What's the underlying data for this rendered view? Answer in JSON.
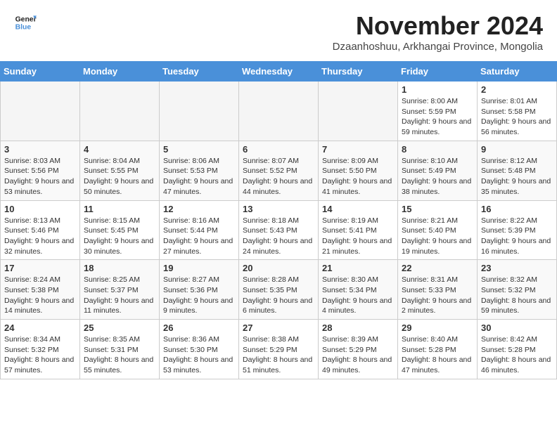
{
  "header": {
    "logo_line1": "General",
    "logo_line2": "Blue",
    "month_title": "November 2024",
    "subtitle": "Dzaanhoshuu, Arkhangai Province, Mongolia"
  },
  "weekdays": [
    "Sunday",
    "Monday",
    "Tuesday",
    "Wednesday",
    "Thursday",
    "Friday",
    "Saturday"
  ],
  "weeks": [
    [
      {
        "day": "",
        "info": ""
      },
      {
        "day": "",
        "info": ""
      },
      {
        "day": "",
        "info": ""
      },
      {
        "day": "",
        "info": ""
      },
      {
        "day": "",
        "info": ""
      },
      {
        "day": "1",
        "info": "Sunrise: 8:00 AM\nSunset: 5:59 PM\nDaylight: 9 hours and 59 minutes."
      },
      {
        "day": "2",
        "info": "Sunrise: 8:01 AM\nSunset: 5:58 PM\nDaylight: 9 hours and 56 minutes."
      }
    ],
    [
      {
        "day": "3",
        "info": "Sunrise: 8:03 AM\nSunset: 5:56 PM\nDaylight: 9 hours and 53 minutes."
      },
      {
        "day": "4",
        "info": "Sunrise: 8:04 AM\nSunset: 5:55 PM\nDaylight: 9 hours and 50 minutes."
      },
      {
        "day": "5",
        "info": "Sunrise: 8:06 AM\nSunset: 5:53 PM\nDaylight: 9 hours and 47 minutes."
      },
      {
        "day": "6",
        "info": "Sunrise: 8:07 AM\nSunset: 5:52 PM\nDaylight: 9 hours and 44 minutes."
      },
      {
        "day": "7",
        "info": "Sunrise: 8:09 AM\nSunset: 5:50 PM\nDaylight: 9 hours and 41 minutes."
      },
      {
        "day": "8",
        "info": "Sunrise: 8:10 AM\nSunset: 5:49 PM\nDaylight: 9 hours and 38 minutes."
      },
      {
        "day": "9",
        "info": "Sunrise: 8:12 AM\nSunset: 5:48 PM\nDaylight: 9 hours and 35 minutes."
      }
    ],
    [
      {
        "day": "10",
        "info": "Sunrise: 8:13 AM\nSunset: 5:46 PM\nDaylight: 9 hours and 32 minutes."
      },
      {
        "day": "11",
        "info": "Sunrise: 8:15 AM\nSunset: 5:45 PM\nDaylight: 9 hours and 30 minutes."
      },
      {
        "day": "12",
        "info": "Sunrise: 8:16 AM\nSunset: 5:44 PM\nDaylight: 9 hours and 27 minutes."
      },
      {
        "day": "13",
        "info": "Sunrise: 8:18 AM\nSunset: 5:43 PM\nDaylight: 9 hours and 24 minutes."
      },
      {
        "day": "14",
        "info": "Sunrise: 8:19 AM\nSunset: 5:41 PM\nDaylight: 9 hours and 21 minutes."
      },
      {
        "day": "15",
        "info": "Sunrise: 8:21 AM\nSunset: 5:40 PM\nDaylight: 9 hours and 19 minutes."
      },
      {
        "day": "16",
        "info": "Sunrise: 8:22 AM\nSunset: 5:39 PM\nDaylight: 9 hours and 16 minutes."
      }
    ],
    [
      {
        "day": "17",
        "info": "Sunrise: 8:24 AM\nSunset: 5:38 PM\nDaylight: 9 hours and 14 minutes."
      },
      {
        "day": "18",
        "info": "Sunrise: 8:25 AM\nSunset: 5:37 PM\nDaylight: 9 hours and 11 minutes."
      },
      {
        "day": "19",
        "info": "Sunrise: 8:27 AM\nSunset: 5:36 PM\nDaylight: 9 hours and 9 minutes."
      },
      {
        "day": "20",
        "info": "Sunrise: 8:28 AM\nSunset: 5:35 PM\nDaylight: 9 hours and 6 minutes."
      },
      {
        "day": "21",
        "info": "Sunrise: 8:30 AM\nSunset: 5:34 PM\nDaylight: 9 hours and 4 minutes."
      },
      {
        "day": "22",
        "info": "Sunrise: 8:31 AM\nSunset: 5:33 PM\nDaylight: 9 hours and 2 minutes."
      },
      {
        "day": "23",
        "info": "Sunrise: 8:32 AM\nSunset: 5:32 PM\nDaylight: 8 hours and 59 minutes."
      }
    ],
    [
      {
        "day": "24",
        "info": "Sunrise: 8:34 AM\nSunset: 5:32 PM\nDaylight: 8 hours and 57 minutes."
      },
      {
        "day": "25",
        "info": "Sunrise: 8:35 AM\nSunset: 5:31 PM\nDaylight: 8 hours and 55 minutes."
      },
      {
        "day": "26",
        "info": "Sunrise: 8:36 AM\nSunset: 5:30 PM\nDaylight: 8 hours and 53 minutes."
      },
      {
        "day": "27",
        "info": "Sunrise: 8:38 AM\nSunset: 5:29 PM\nDaylight: 8 hours and 51 minutes."
      },
      {
        "day": "28",
        "info": "Sunrise: 8:39 AM\nSunset: 5:29 PM\nDaylight: 8 hours and 49 minutes."
      },
      {
        "day": "29",
        "info": "Sunrise: 8:40 AM\nSunset: 5:28 PM\nDaylight: 8 hours and 47 minutes."
      },
      {
        "day": "30",
        "info": "Sunrise: 8:42 AM\nSunset: 5:28 PM\nDaylight: 8 hours and 46 minutes."
      }
    ]
  ]
}
